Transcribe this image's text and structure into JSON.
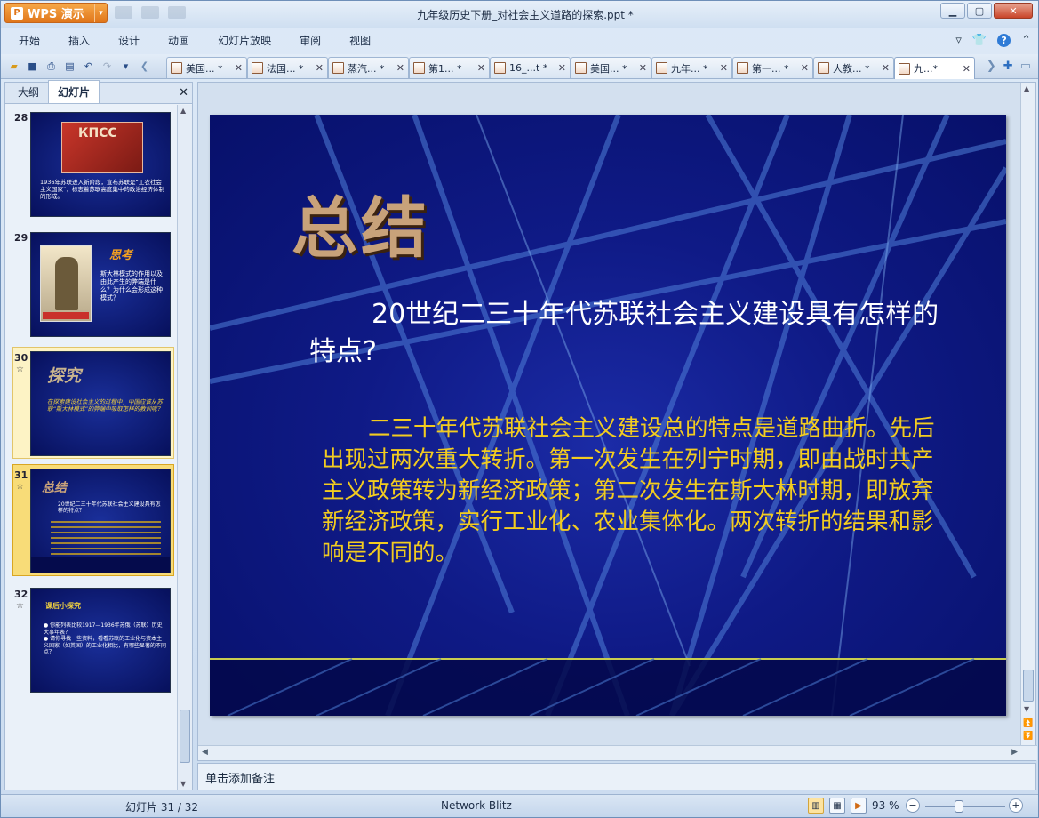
{
  "app": {
    "name": "WPS 演示",
    "window_title": "九年级历史下册_对社会主义道路的探索.ppt *"
  },
  "menu": [
    "开始",
    "插入",
    "设计",
    "动画",
    "幻灯片放映",
    "审阅",
    "视图"
  ],
  "doc_tabs": [
    {
      "label": "美国...",
      "modified": "*"
    },
    {
      "label": "法国...",
      "modified": "*"
    },
    {
      "label": "蒸汽...",
      "modified": "*"
    },
    {
      "label": "第1...",
      "modified": "*"
    },
    {
      "label": "16_...t",
      "modified": "*"
    },
    {
      "label": "美国...",
      "modified": "*"
    },
    {
      "label": "九年...",
      "modified": "*"
    },
    {
      "label": "第一...",
      "modified": "*"
    },
    {
      "label": "人教...",
      "modified": "*"
    },
    {
      "label": "九...",
      "modified": "*"
    }
  ],
  "left_pane": {
    "tabs": [
      "大纲",
      "幻灯片"
    ],
    "thumbs": [
      {
        "num": "28",
        "text": "1936年苏联进入新阶段，宣布苏联是“工农社会主义国家”，标志着苏联高度集中的政治经济体制的形成。",
        "title": "КПСС"
      },
      {
        "num": "29",
        "text": "斯大林模式的作用以及由此产生的弊端是什么？为什么会形成这种模式？",
        "title": "思考"
      },
      {
        "num": "30",
        "text": "在探索建设社会主义的过程中，中国应该从苏联“斯大林模式”的弊端中吸取怎样的教训呢？",
        "title": "探究"
      },
      {
        "num": "31",
        "text": "20世纪二三十年代苏联社会主义建设具有怎样的特点？",
        "title": "总结"
      },
      {
        "num": "32",
        "text": "● 你能列表比较1917—1936年苏俄（苏联）历史大事年表？\n● 请你寻找一些资料，看看苏联的工业化与资本主义国家（如英国）的工业化相比，有哪些显著的不同点？",
        "title": "课后小探究"
      }
    ]
  },
  "slide": {
    "title": "总结",
    "question": "20世纪二三十年代苏联社会主义建设具有怎样的特点?",
    "answer": "二三十年代苏联社会主义建设总的特点是道路曲折。先后出现过两次重大转折。第一次发生在列宁时期，即由战时共产主义政策转为新经济政策；第二次发生在斯大林时期，即放弃新经济政策，实行工业化、农业集体化。两次转折的结果和影响是不同的。"
  },
  "notes": {
    "placeholder": "单击添加备注"
  },
  "status": {
    "slide_indicator": "幻灯片 31 / 32",
    "theme": "Network Blitz",
    "zoom": "93 %"
  }
}
